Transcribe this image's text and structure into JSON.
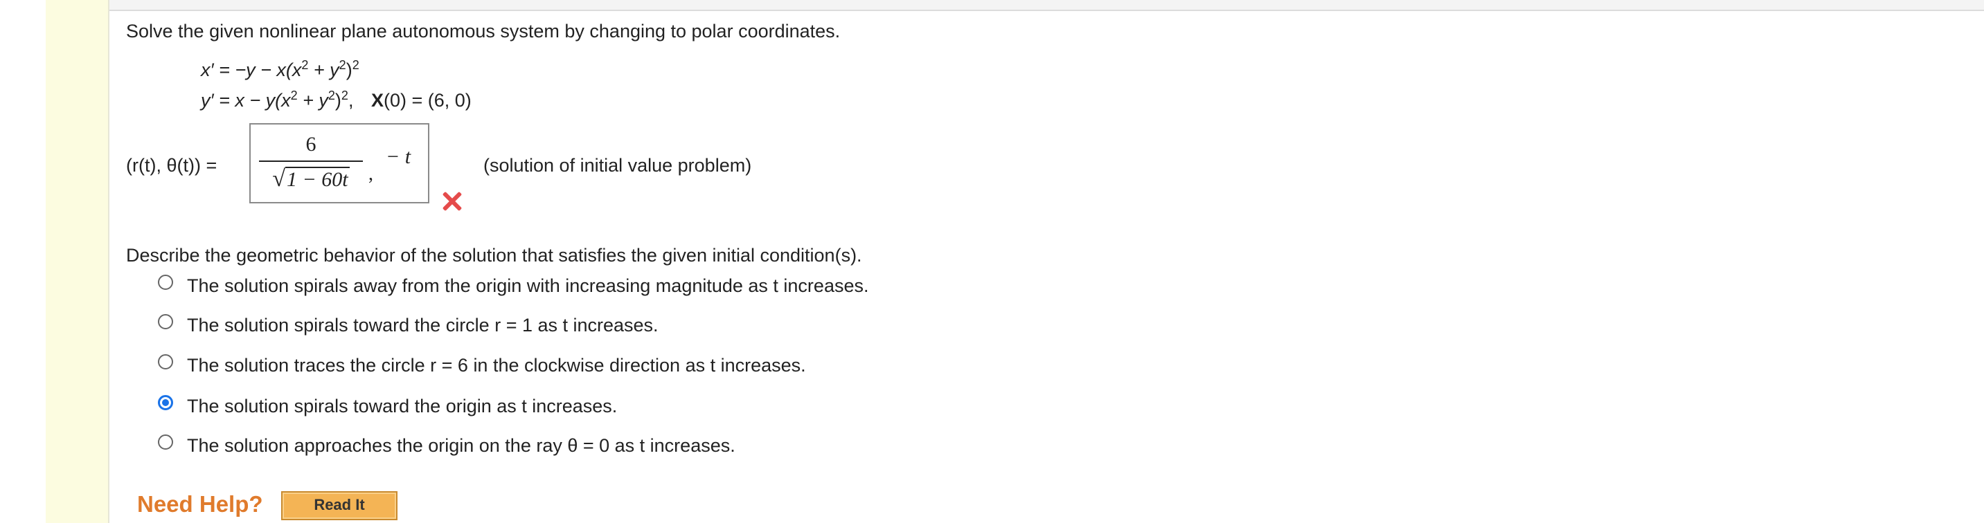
{
  "question": {
    "prompt": "Solve the given nonlinear plane autonomous system by changing to polar coordinates.",
    "eq1_lhs": "x′ = ",
    "eq1_rhs_a": "−y − x(x",
    "eq1_sup1": "2",
    "eq1_rhs_b": " + y",
    "eq1_sup2": "2",
    "eq1_rhs_c": ")",
    "eq1_sup3": "2",
    "eq2_lhs": "y′ = ",
    "eq2_rhs_a": "x − y(x",
    "eq2_sup1": "2",
    "eq2_rhs_b": " + y",
    "eq2_sup2": "2",
    "eq2_rhs_c": ")",
    "eq2_sup3": "2",
    "eq2_tail": ",",
    "initial_bold": "X",
    "initial_rest": "(0) = (6, 0)"
  },
  "answer": {
    "label": "(r(t), θ(t)) = ",
    "numerator": "6",
    "sqrt_symbol": "√",
    "denominator": "1 − 60t",
    "comma": ",",
    "second": "− t",
    "note": "(solution of initial value problem)",
    "status": "incorrect"
  },
  "part2": {
    "prompt": "Describe the geometric behavior of the solution that satisfies the given initial condition(s).",
    "options": [
      {
        "label": "The solution spirals away from the origin with increasing magnitude as t increases.",
        "selected": false
      },
      {
        "label": "The solution spirals toward the circle r = 1 as t increases.",
        "selected": false
      },
      {
        "label": "The solution traces the circle r = 6 in the clockwise direction as t increases.",
        "selected": false
      },
      {
        "label": "The solution spirals toward the origin as t increases.",
        "selected": true
      },
      {
        "label": "The solution approaches the origin on the ray θ = 0 as t increases.",
        "selected": false
      }
    ]
  },
  "help": {
    "need_help": "Need Help?",
    "read_it": "Read It"
  },
  "colors": {
    "left_strip": "#fcfce0",
    "selected_radio": "#1a73e8",
    "error_mark": "#e54b4b",
    "need_help_text": "#e07b2c",
    "read_it_button": "#f4b455"
  }
}
